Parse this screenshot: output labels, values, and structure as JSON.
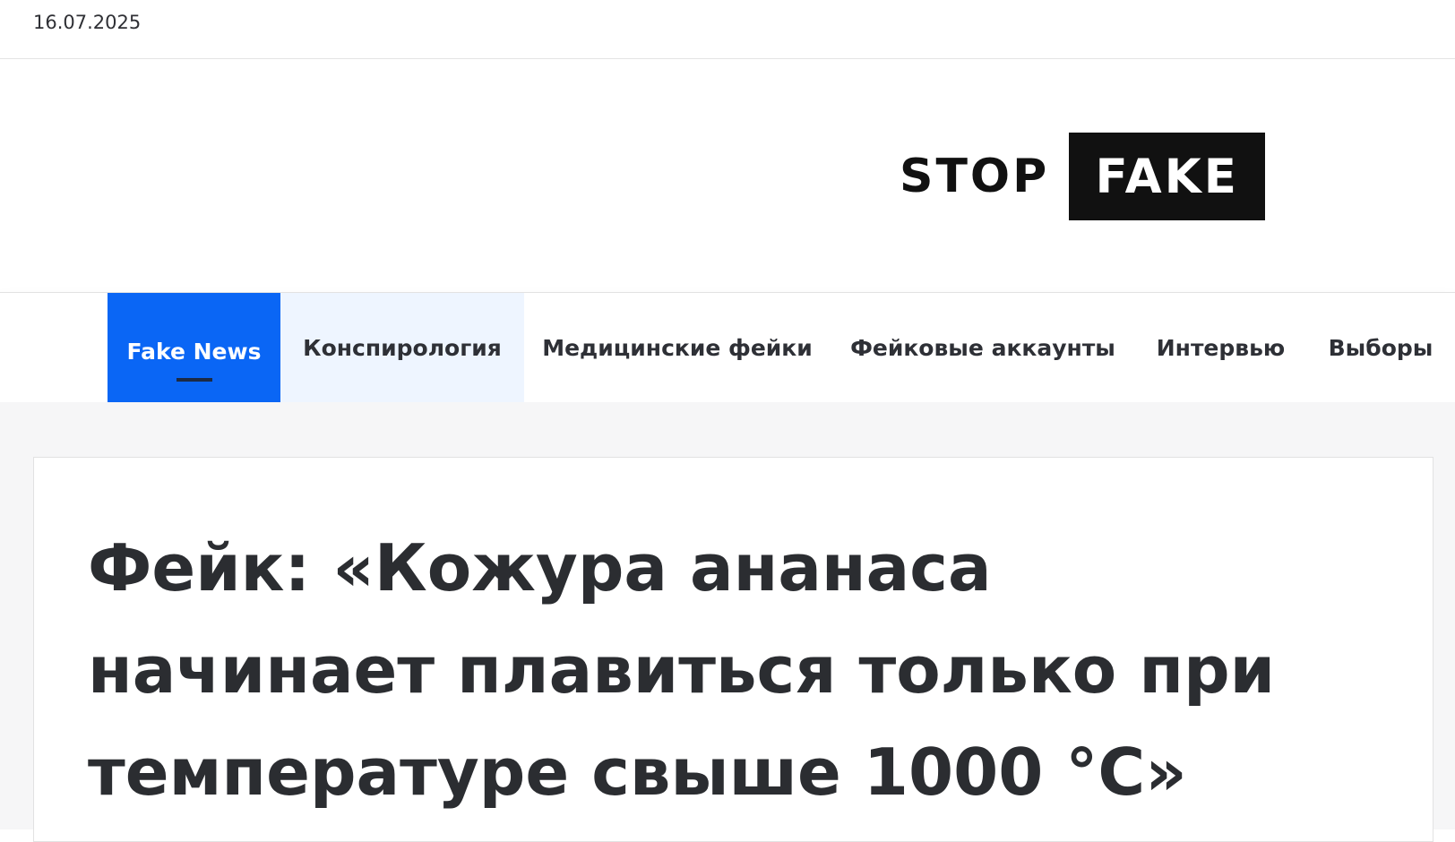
{
  "topbar": {
    "date": "16.07.2025"
  },
  "logo": {
    "stop": "STOP",
    "fake": "FAKE"
  },
  "nav": {
    "items": [
      {
        "label": "Fake News",
        "state": "active"
      },
      {
        "label": "Конспирология",
        "state": "hover"
      },
      {
        "label": "Медицинские фейки",
        "state": "normal"
      },
      {
        "label": "Фейковые аккаунты",
        "state": "normal"
      },
      {
        "label": "Интервью",
        "state": "normal"
      },
      {
        "label": "Выборы",
        "state": "normal"
      }
    ]
  },
  "article": {
    "title": "Фейк: «Кожура ананаса начинает плавиться только при температуре свыше 1000 °C»"
  },
  "colors": {
    "accent": "#0a66f5",
    "hover_bg": "#eef5ff",
    "logo_bg": "#111111",
    "text": "#2b2d31"
  }
}
